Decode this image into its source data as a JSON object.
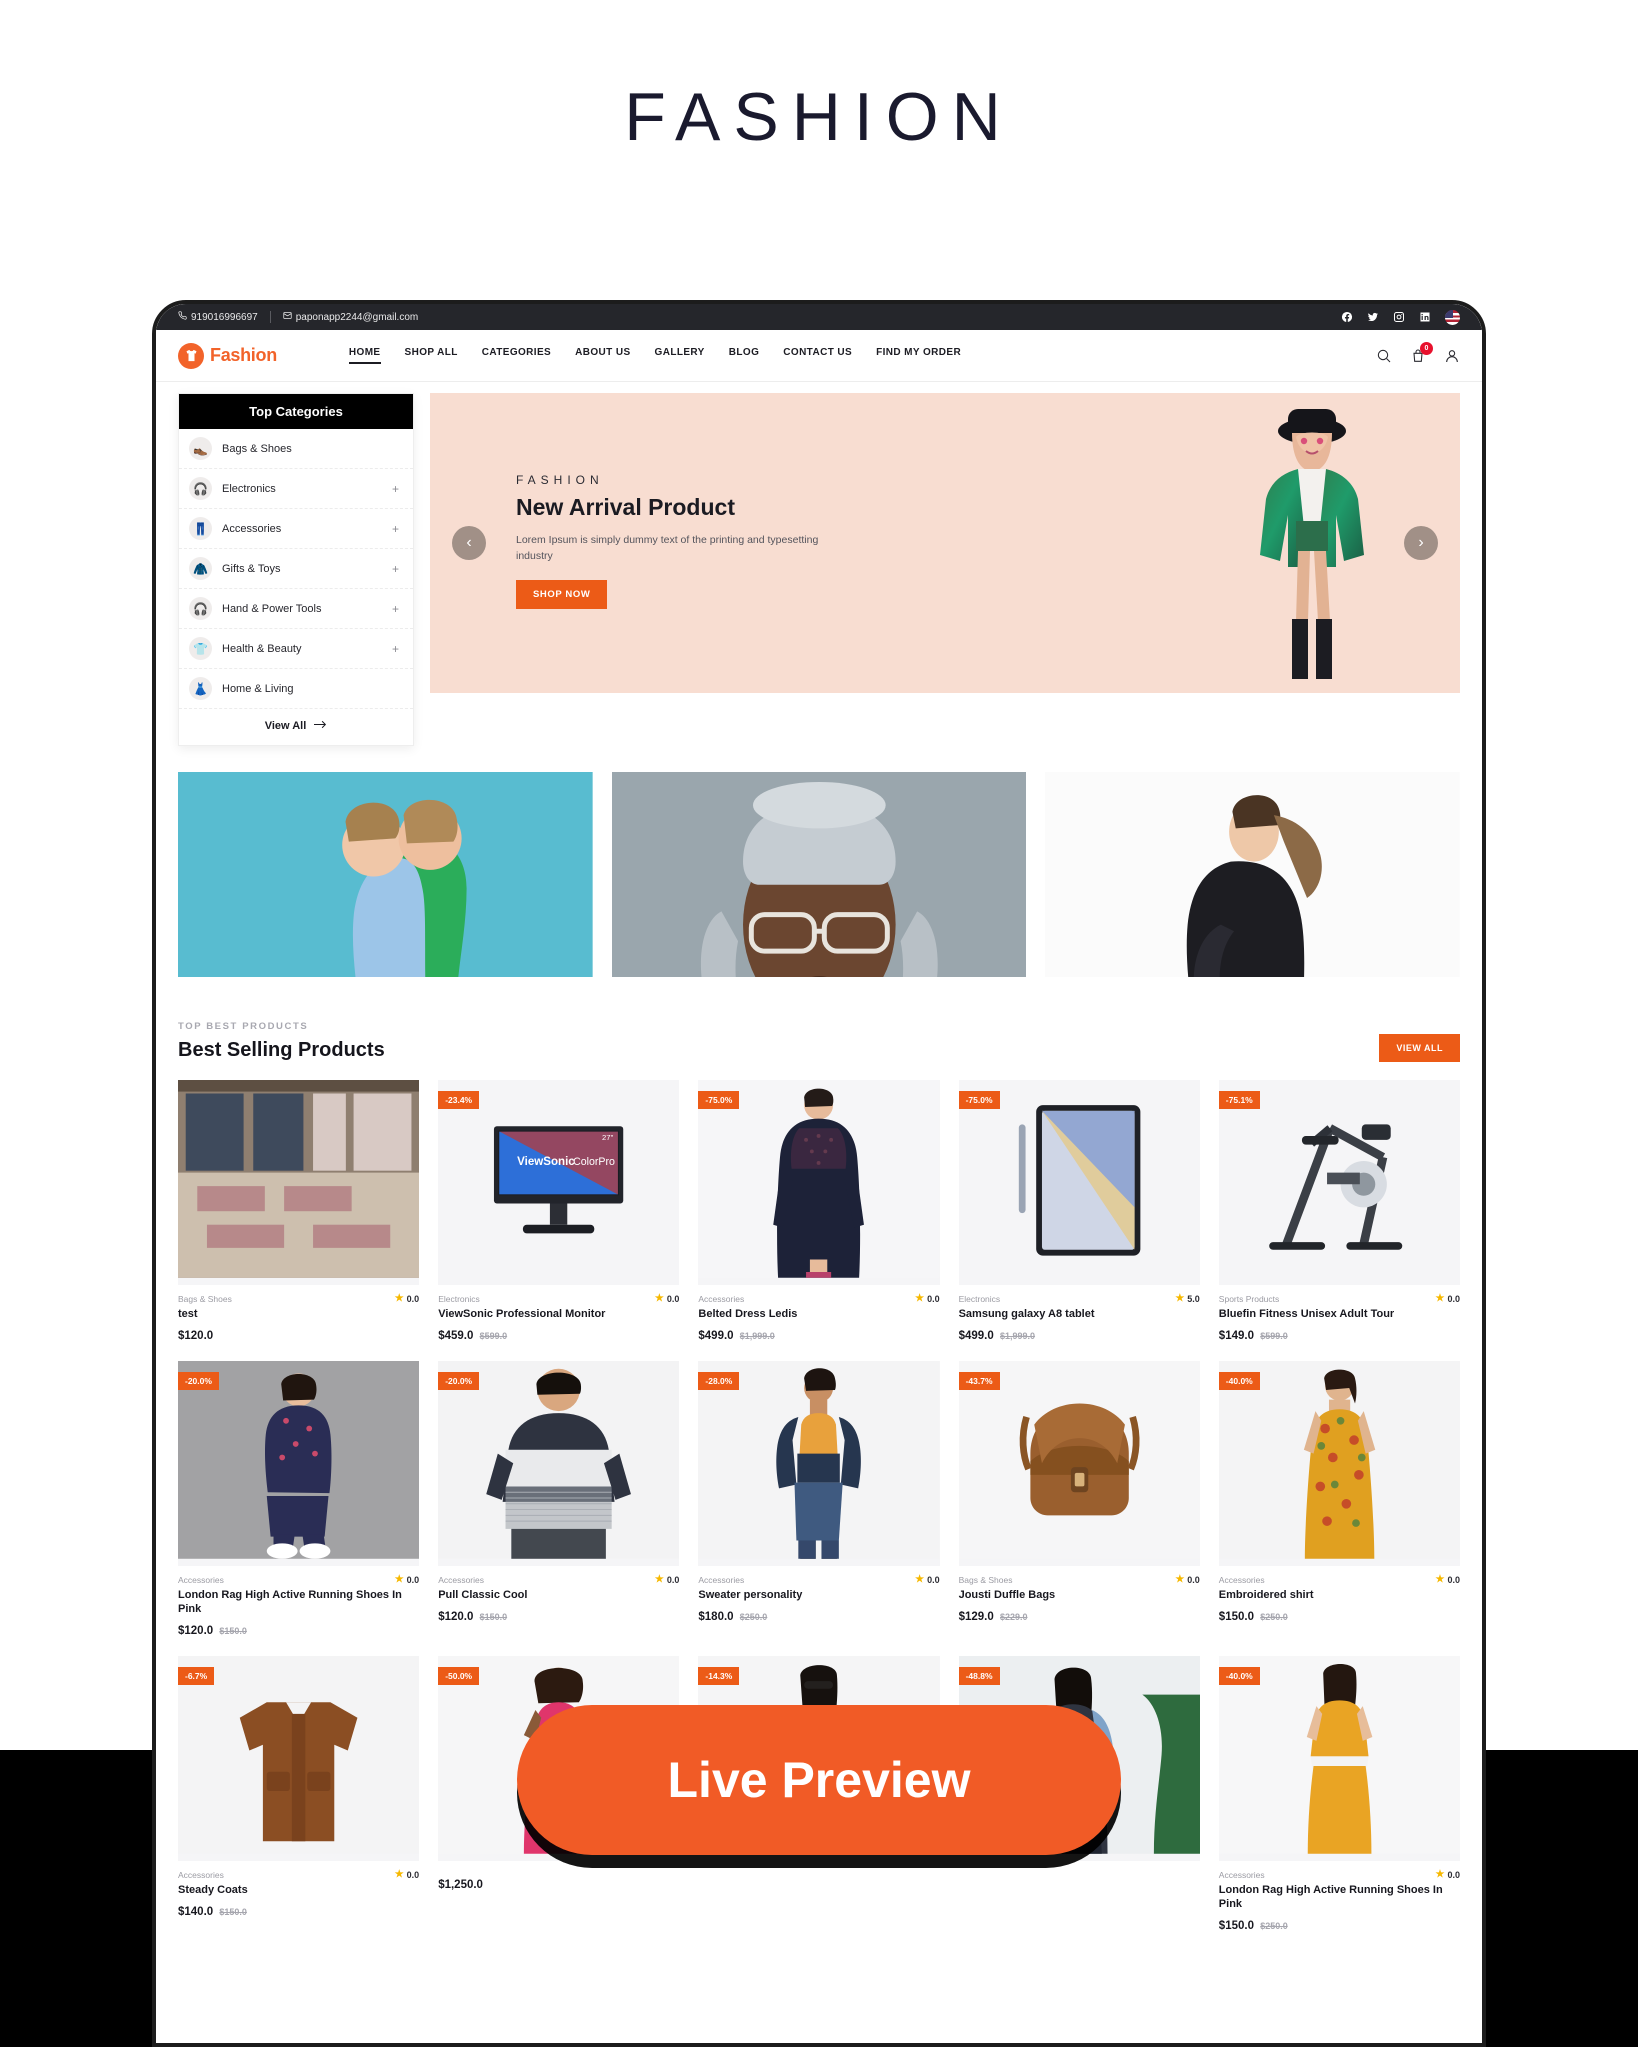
{
  "page": {
    "title": "FASHION",
    "cta": "Live Preview"
  },
  "topbar": {
    "phone": "919016996697",
    "email": "paponapp2244@gmail.com",
    "phone_icon": "phone-icon",
    "email_icon": "envelope-icon",
    "socials": [
      "facebook-icon",
      "twitter-icon",
      "instagram-icon",
      "linkedin-icon"
    ],
    "flag": "us-flag-icon"
  },
  "nav": {
    "logo_text": "Fashion",
    "logo_icon": "tshirt-icon",
    "links": [
      {
        "label": "HOME",
        "active": true
      },
      {
        "label": "SHOP ALL",
        "active": false
      },
      {
        "label": "CATEGORIES",
        "active": false
      },
      {
        "label": "ABOUT US",
        "active": false
      },
      {
        "label": "GALLERY",
        "active": false
      },
      {
        "label": "BLOG",
        "active": false
      },
      {
        "label": "CONTACT US",
        "active": false
      },
      {
        "label": "FIND MY ORDER",
        "active": false
      }
    ],
    "search_icon": "search-icon",
    "cart_icon": "cart-icon",
    "cart_count": "0",
    "account_icon": "user-icon"
  },
  "categories": {
    "heading": "Top Categories",
    "items": [
      {
        "label": "Bags & Shoes",
        "icon": "boot-icon",
        "glyph": "👞",
        "expandable": false
      },
      {
        "label": "Electronics",
        "icon": "headphone-icon",
        "glyph": "🎧",
        "expandable": true
      },
      {
        "label": "Accessories",
        "icon": "trousers-icon",
        "glyph": "👖",
        "expandable": true
      },
      {
        "label": "Gifts & Toys",
        "icon": "sweater-icon",
        "glyph": "🧥",
        "expandable": true
      },
      {
        "label": "Hand & Power Tools",
        "icon": "headphone-icon",
        "glyph": "🎧",
        "expandable": true
      },
      {
        "label": "Health & Beauty",
        "icon": "tshirt-icon",
        "glyph": "👕",
        "expandable": true
      },
      {
        "label": "Home & Living",
        "icon": "skirt-icon",
        "glyph": "👗",
        "expandable": false
      }
    ],
    "expand_symbol": "+",
    "view_all": "View All",
    "view_all_icon": "arrow-right-icon"
  },
  "hero": {
    "kicker": "FASHION",
    "title": "New Arrival Product",
    "description": "Lorem Ipsum is simply dummy text of the printing and typesetting industry",
    "button": "SHOP NOW",
    "prev_icon": "chevron-left-icon",
    "next_icon": "chevron-right-icon",
    "bg_color": "#f8ddd1"
  },
  "promos": [
    {
      "name": "promo-banner-1",
      "alt": "Two women in blue and green outfits"
    },
    {
      "name": "promo-banner-2",
      "alt": "Person with beanie and glasses"
    },
    {
      "name": "promo-banner-3",
      "alt": "Woman in black jacket walking"
    }
  ],
  "section": {
    "kicker": "TOP BEST PRODUCTS",
    "title": "Best Selling Products",
    "view_all": "VIEW ALL"
  },
  "accent_colors": {
    "orange": "#ec5b17",
    "badge_red": "#e8112d",
    "star_yellow": "#f6b800",
    "dark": "#1c1c23"
  },
  "products": [
    {
      "badge": null,
      "category": "Bags & Shoes",
      "rating": "0.0",
      "name": "test",
      "price": "$120.0",
      "old_price": null,
      "img": "closet-rack"
    },
    {
      "badge": "-23.4%",
      "category": "Electronics",
      "rating": "0.0",
      "name": "ViewSonic Professional Monitor",
      "price": "$459.0",
      "old_price": "$599.0",
      "img": "monitor"
    },
    {
      "badge": "-75.0%",
      "category": "Accessories",
      "rating": "0.0",
      "name": "Belted Dress Ledis",
      "price": "$499.0",
      "old_price": "$1,999.0",
      "img": "navy-dress"
    },
    {
      "badge": "-75.0%",
      "category": "Electronics",
      "rating": "5.0",
      "name": "Samsung galaxy A8 tablet",
      "price": "$499.0",
      "old_price": "$1,999.0",
      "img": "tablet"
    },
    {
      "badge": "-75.1%",
      "category": "Sports Products",
      "rating": "0.0",
      "name": "Bluefin Fitness Unisex Adult Tour",
      "price": "$149.0",
      "old_price": "$599.0",
      "img": "exercise-bike"
    },
    {
      "badge": "-20.0%",
      "category": "Accessories",
      "rating": "0.0",
      "name": "London Rag High Active Running Shoes In Pink",
      "price": "$120.0",
      "old_price": "$150.0",
      "img": "jumpsuit-woman"
    },
    {
      "badge": "-20.0%",
      "category": "Accessories",
      "rating": "0.0",
      "name": "Pull Classic Cool",
      "price": "$120.0",
      "old_price": "$150.0",
      "img": "striped-tee-man"
    },
    {
      "badge": "-28.0%",
      "category": "Accessories",
      "rating": "0.0",
      "name": "Sweater personality",
      "price": "$180.0",
      "old_price": "$250.0",
      "img": "denim-woman"
    },
    {
      "badge": "-43.7%",
      "category": "Bags & Shoes",
      "rating": "0.0",
      "name": "Jousti Duffle Bags",
      "price": "$129.0",
      "old_price": "$229.0",
      "img": "leather-bag"
    },
    {
      "badge": "-40.0%",
      "category": "Accessories",
      "rating": "0.0",
      "name": "Embroidered shirt",
      "price": "$150.0",
      "old_price": "$250.0",
      "img": "yellow-dress"
    },
    {
      "badge": "-6.7%",
      "category": "Accessories",
      "rating": "0.0",
      "name": "Steady Coats",
      "price": "$140.0",
      "old_price": "$150.0",
      "img": "brown-jacket"
    },
    {
      "badge": "-50.0%",
      "category": "",
      "rating": "",
      "name": "",
      "price": "$1,250.0",
      "old_price": null,
      "img": "pink-dress"
    },
    {
      "badge": "-14.3%",
      "category": "",
      "rating": "",
      "name": "",
      "price": "",
      "old_price": null,
      "img": "floral-dress"
    },
    {
      "badge": "-48.8%",
      "category": "",
      "rating": "",
      "name": "",
      "price": "",
      "old_price": null,
      "img": "denim-jacket-woman"
    },
    {
      "badge": "-40.0%",
      "category": "Accessories",
      "rating": "0.0",
      "name": "London Rag High Active Running Shoes In Pink",
      "price": "$150.0",
      "old_price": "$250.0",
      "img": "orange-outfit"
    }
  ]
}
